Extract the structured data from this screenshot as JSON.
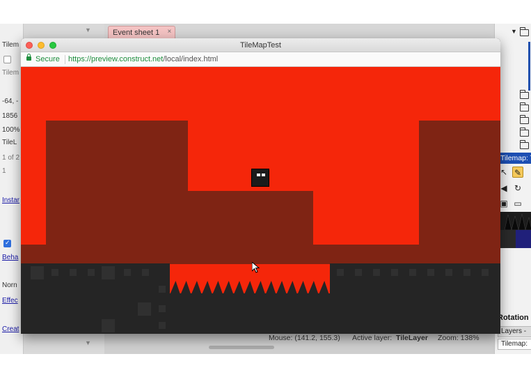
{
  "editor": {
    "left_panel": {
      "rows": [
        "Tilem",
        "Tilem",
        "-64, -",
        "1856",
        "100%",
        "TileL",
        "1 of 2",
        "1",
        "Norn"
      ],
      "links": [
        "Instar",
        "Beha",
        "Effec",
        "Creat"
      ],
      "checkbox_checked": true
    },
    "document_tab": {
      "label": "Event sheet 1",
      "close": "×"
    },
    "status": {
      "mouse": "Mouse: (141.2, 155.3)",
      "active_layer_label": "Active layer:",
      "active_layer_value": "TileLayer",
      "zoom": "Zoom: 138%"
    },
    "right_panel": {
      "tilemap_header": "Tilemap: T",
      "rotation_label": "Rotation",
      "layers_tab": "Layers -",
      "tilemap_tab": "Tilemap:"
    }
  },
  "browser": {
    "title": "TileMapTest",
    "secure_label": "Secure",
    "url_host": "https://preview.construct.net",
    "url_path": "/local/index.html"
  },
  "game": {
    "sky_color": "#f5260a",
    "wall_color": "#7f2414",
    "floor_color": "#252525",
    "spike_count": 15
  }
}
